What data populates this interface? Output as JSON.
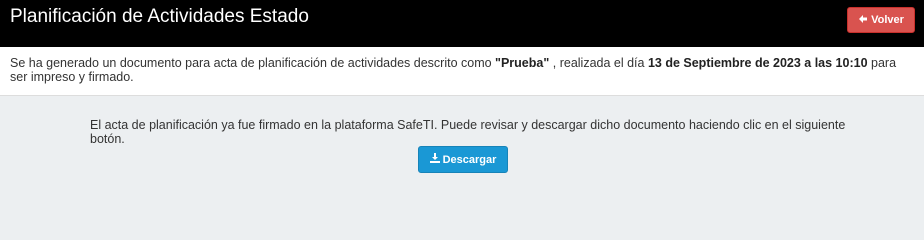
{
  "header": {
    "title": "Planificación de Actividades Estado",
    "back_label": "Volver",
    "back_icon": "arrow-left-icon"
  },
  "info": {
    "text_before": "Se ha generado un documento para acta de planificación de actividades descrito como ",
    "document_name": "\"Prueba\"",
    "text_middle": " , realizada el día ",
    "date": "13 de Septiembre de 2023 a las 10:10",
    "text_after": " para ser impreso y firmado."
  },
  "main": {
    "message": "El acta de planificación ya fue firmado en la plataforma SafeTI. Puede revisar y descargar dicho documento haciendo clic en el siguiente botón.",
    "download_label": "Descargar",
    "download_icon": "download-icon"
  },
  "colors": {
    "header_bg": "#000000",
    "back_button": "#d9534f",
    "download_button": "#1a98d5",
    "main_bg": "#eceff1"
  }
}
